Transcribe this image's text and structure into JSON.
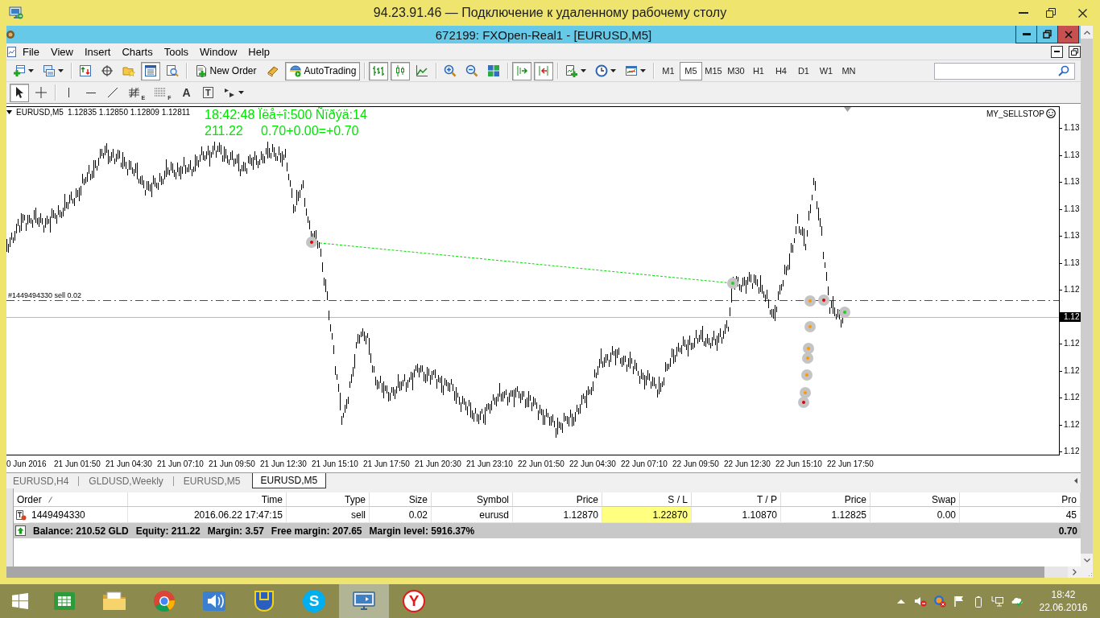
{
  "rdp_window": {
    "title": "94.23.91.46 — Подключение к удаленному рабочему столу"
  },
  "app_window": {
    "title": "672199: FXOpen-Real1 - [EURUSD,M5]"
  },
  "menu": [
    "File",
    "View",
    "Insert",
    "Charts",
    "Tools",
    "Window",
    "Help"
  ],
  "toolbar": [
    {
      "kind": "new-chart",
      "pressed": false,
      "dropdown": true
    },
    {
      "kind": "profiles",
      "pressed": false,
      "dropdown": true
    },
    {
      "kind": "separator"
    },
    {
      "kind": "market-watch",
      "pressed": false
    },
    {
      "kind": "data-window",
      "pressed": false
    },
    {
      "kind": "navigator",
      "pressed": false
    },
    {
      "kind": "terminal",
      "pressed": true
    },
    {
      "kind": "tester",
      "pressed": false
    },
    {
      "kind": "separator"
    },
    {
      "kind": "new-order",
      "label": "New Order",
      "pressed": false
    },
    {
      "kind": "metaeditor",
      "pressed": false
    },
    {
      "kind": "auto-trading",
      "label": "AutoTrading",
      "pressed": true
    },
    {
      "kind": "separator"
    },
    {
      "kind": "bar-chart",
      "pressed": true
    },
    {
      "kind": "candlesticks",
      "pressed": true
    },
    {
      "kind": "line-chart",
      "pressed": false
    },
    {
      "kind": "separator"
    },
    {
      "kind": "zoom-in",
      "pressed": false
    },
    {
      "kind": "zoom-out",
      "pressed": false
    },
    {
      "kind": "tile-windows",
      "pressed": false
    },
    {
      "kind": "separator"
    },
    {
      "kind": "auto-scroll",
      "pressed": true
    },
    {
      "kind": "chart-shift",
      "pressed": true
    },
    {
      "kind": "separator"
    },
    {
      "kind": "indicators",
      "pressed": false,
      "dropdown": true
    },
    {
      "kind": "periods",
      "pressed": false,
      "dropdown": true
    },
    {
      "kind": "templates",
      "pressed": false,
      "dropdown": true
    },
    {
      "kind": "separator"
    }
  ],
  "timeframes": [
    {
      "label": "M1",
      "selected": false
    },
    {
      "label": "M5",
      "selected": true
    },
    {
      "label": "M15",
      "selected": false
    },
    {
      "label": "M30",
      "selected": false
    },
    {
      "label": "H1",
      "selected": false
    },
    {
      "label": "H4",
      "selected": false
    },
    {
      "label": "D1",
      "selected": false
    },
    {
      "label": "W1",
      "selected": false
    },
    {
      "label": "MN",
      "selected": false
    }
  ],
  "drawing_toolbar": [
    {
      "kind": "cursor",
      "pressed": true
    },
    {
      "kind": "crosshair",
      "pressed": false
    },
    {
      "kind": "separator"
    },
    {
      "kind": "vertical-line",
      "pressed": false
    },
    {
      "kind": "horizontal-line",
      "pressed": false
    },
    {
      "kind": "trendline",
      "pressed": false
    },
    {
      "kind": "fibonacci",
      "glyph": "E",
      "pressed": false
    },
    {
      "kind": "grid",
      "glyph": "F",
      "pressed": false
    },
    {
      "kind": "text",
      "glyph": "A",
      "pressed": false
    },
    {
      "kind": "label",
      "glyph": "T",
      "pressed": false
    },
    {
      "kind": "arrows",
      "pressed": false,
      "dropdown": true
    }
  ],
  "chart": {
    "symbol": "EURUSD,M5",
    "ohlc": "1.12835 1.12850 1.12809 1.12811",
    "clock_line": "18:42:48 Ïëå÷î:500 Ñïðýä:14",
    "equity": "211.22",
    "profit_line": "0.70+0.00=+0.70",
    "expert": "MY_SELLSTOP",
    "order_line": "#1449494330 sell 0.02",
    "price_labels": [
      {
        "text": "1.13",
        "current": false
      },
      {
        "text": "1.13",
        "current": false
      },
      {
        "text": "1.13",
        "current": false
      },
      {
        "text": "1.13",
        "current": false
      },
      {
        "text": "1.13",
        "current": false
      },
      {
        "text": "1.13",
        "current": false
      },
      {
        "text": "1.12",
        "current": false
      },
      {
        "text": "1.12",
        "current": true
      },
      {
        "text": "1.12",
        "current": false
      },
      {
        "text": "1.12",
        "current": false
      },
      {
        "text": "1.12",
        "current": false
      },
      {
        "text": "1.12",
        "current": false
      },
      {
        "text": "1.12",
        "current": false
      }
    ],
    "time_labels": [
      "0 Jun 2016",
      "21 Jun 01:50",
      "21 Jun 04:30",
      "21 Jun 07:10",
      "21 Jun 09:50",
      "21 Jun 12:30",
      "21 Jun 15:10",
      "21 Jun 17:50",
      "21 Jun 20:30",
      "21 Jun 23:10",
      "22 Jun 01:50",
      "22 Jun 04:30",
      "22 Jun 07:10",
      "22 Jun 09:50",
      "22 Jun 12:30",
      "22 Jun 15:10",
      "22 Jun 17:50"
    ]
  },
  "chart_tabs": [
    {
      "label": "EURUSD,H4",
      "selected": false
    },
    {
      "label": "GLDUSD,Weekly",
      "selected": false
    },
    {
      "label": "EURUSD,M5",
      "selected": false
    },
    {
      "label": "EURUSD,M5",
      "selected": true
    }
  ],
  "terminal": {
    "columns": [
      {
        "label": "Order",
        "sorted": true
      },
      {
        "label": "Time",
        "sorted": false
      },
      {
        "label": "Type",
        "sorted": false
      },
      {
        "label": "Size",
        "sorted": false
      },
      {
        "label": "Symbol",
        "sorted": false
      },
      {
        "label": "Price",
        "sorted": false
      },
      {
        "label": "S / L",
        "sorted": false
      },
      {
        "label": "T / P",
        "sorted": false
      },
      {
        "label": "Price",
        "sorted": false
      },
      {
        "label": "Swap",
        "sorted": false
      },
      {
        "label": "Pro",
        "sorted": false
      }
    ],
    "rows": [
      {
        "cells": [
          {
            "text": "1449494330",
            "highlighted": false
          },
          {
            "text": "2016.06.22 17:47:15",
            "highlighted": false
          },
          {
            "text": "sell",
            "highlighted": false
          },
          {
            "text": "0.02",
            "highlighted": false
          },
          {
            "text": "eurusd",
            "highlighted": false
          },
          {
            "text": "1.12870",
            "highlighted": false
          },
          {
            "text": "1.22870",
            "highlighted": true
          },
          {
            "text": "1.10870",
            "highlighted": false
          },
          {
            "text": "1.12825",
            "highlighted": false
          },
          {
            "text": "0.00",
            "highlighted": false
          },
          {
            "text": "45",
            "highlighted": false
          }
        ]
      }
    ],
    "summary": [
      "Balance: 210.52 GLD",
      "Equity: 211.22",
      "Margin: 3.57",
      "Free margin: 207.65",
      "Margin level: 5916.37%"
    ],
    "summary_profit": "0.70"
  },
  "taskbar": {
    "apps": [
      {
        "kind": "tiles",
        "active": false
      },
      {
        "kind": "folder",
        "active": false
      },
      {
        "kind": "browser",
        "active": false
      },
      {
        "kind": "speaker",
        "active": false
      },
      {
        "kind": "blue-yellow",
        "active": false
      },
      {
        "kind": "blue-letter",
        "glyph": "S",
        "active": false
      },
      {
        "kind": "remote-desktop",
        "active": true
      },
      {
        "kind": "red-letter",
        "glyph": "Y",
        "active": false
      }
    ],
    "tray": [
      {
        "kind": "up-arrow"
      },
      {
        "kind": "speaker-muted"
      },
      {
        "kind": "round-status"
      },
      {
        "kind": "flag"
      },
      {
        "kind": "battery"
      },
      {
        "kind": "network"
      },
      {
        "kind": "cloud-check"
      }
    ],
    "time": "18:42",
    "date": "22.06.2016"
  }
}
